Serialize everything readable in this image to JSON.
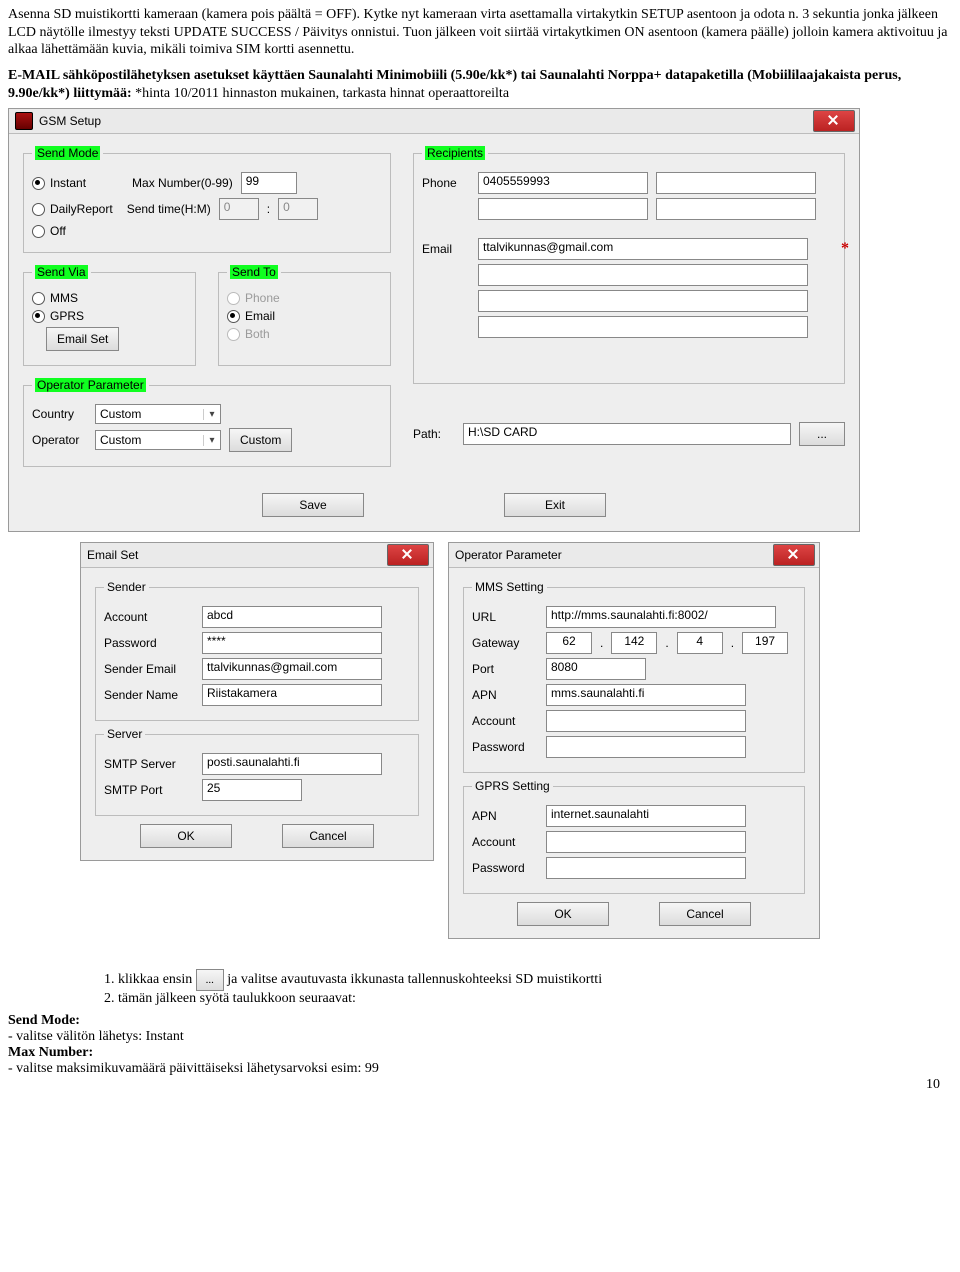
{
  "intro": "Asenna SD muistikortti kameraan (kamera pois päältä = OFF). Kytke nyt kameraan virta asettamalla virtakytkin SETUP asentoon ja odota n. 3 sekuntia jonka jälkeen LCD näytölle ilmestyy teksti UPDATE SUCCESS / Päivitys onnistui. Tuon jälkeen voit siirtää virtakytkimen ON asentoon (kamera päälle) jolloin kamera aktivoituu ja alkaa lähettämään kuvia, mikäli toimiva SIM kortti asennettu.",
  "heading_strong": "E-MAIL sähköpostilähetyksen asetukset käyttäen Saunalahti Minimobiili (5.90e/kk*) tai Saunalahti Norppa+ datapaketilla (Mobiililaajakaista perus, 9.90e/kk*) liittymää: ",
  "heading_light": "*hinta 10/2011 hinnaston mukainen, tarkasta hinnat operaattoreilta",
  "gsm": {
    "title": "GSM Setup",
    "sendmode_legend": "Send Mode",
    "instant": "Instant",
    "daily": "DailyReport",
    "off": "Off",
    "maxnum_label": "Max Number(0-99)",
    "maxnum_value": "99",
    "sendtime_label": "Send time(H:M)",
    "hour": "0",
    "min": "0",
    "colon": ":",
    "sendvia_legend": "Send Via",
    "mms": "MMS",
    "gprs": "GPRS",
    "emailset_btn": "Email Set",
    "sendto_legend": "Send To",
    "to_phone": "Phone",
    "to_email": "Email",
    "to_both": "Both",
    "opparam_legend": "Operator Parameter",
    "country_label": "Country",
    "country_value": "Custom",
    "operator_label": "Operator",
    "operator_value": "Custom",
    "custom_btn": "Custom",
    "recipients_legend": "Recipients",
    "phone_label": "Phone",
    "phone_value": "0405559993",
    "email_label": "Email",
    "email_value": "ttalvikunnas@gmail.com",
    "path_label": "Path:",
    "path_value": "H:\\SD CARD",
    "dots_btn": "...",
    "save_btn": "Save",
    "exit_btn": "Exit"
  },
  "emailset": {
    "title": "Email Set",
    "sender_legend": "Sender",
    "account_label": "Account",
    "account_value": "abcd",
    "password_label": "Password",
    "password_value": "****",
    "senderemail_label": "Sender Email",
    "senderemail_value": "ttalvikunnas@gmail.com",
    "sendername_label": "Sender Name",
    "sendername_value": "Riistakamera",
    "server_legend": "Server",
    "smtp_label": "SMTP Server",
    "smtp_value": "posti.saunalahti.fi",
    "port_label": "SMTP Port",
    "port_value": "25",
    "ok_btn": "OK",
    "cancel_btn": "Cancel"
  },
  "opparam": {
    "title": "Operator Parameter",
    "mms_legend": "MMS Setting",
    "url_label": "URL",
    "url_value": "http://mms.saunalahti.fi:8002/",
    "gateway_label": "Gateway",
    "g1": "62",
    "g2": "142",
    "g3": "4",
    "g4": "197",
    "dot": ".",
    "port_label": "Port",
    "port_value": "8080",
    "apn_label": "APN",
    "apn_value": "mms.saunalahti.fi",
    "account_label": "Account",
    "password_label": "Password",
    "gprs_legend": "GPRS Setting",
    "gapn_label": "APN",
    "gapn_value": "internet.saunalahti",
    "gaccount_label": "Account",
    "gpassword_label": "Password",
    "ok_btn": "OK",
    "cancel_btn": "Cancel"
  },
  "bottom": {
    "li1a": "klikkaa ensin ",
    "li1b": " ja valitse avautuvasta ikkunasta tallennuskohteeksi SD muistikortti",
    "li2": "tämän jälkeen syötä taulukkoon seuraavat:",
    "sendmode_hd": "Send Mode:",
    "sendmode_tx": "- valitse välitön lähetys: Instant",
    "maxnum_hd": "Max Number:",
    "maxnum_tx": "- valitse maksimikuvamäärä päivittäiseksi lähetysarvoksi esim: 99",
    "dots": "..."
  },
  "pagenum": "10"
}
